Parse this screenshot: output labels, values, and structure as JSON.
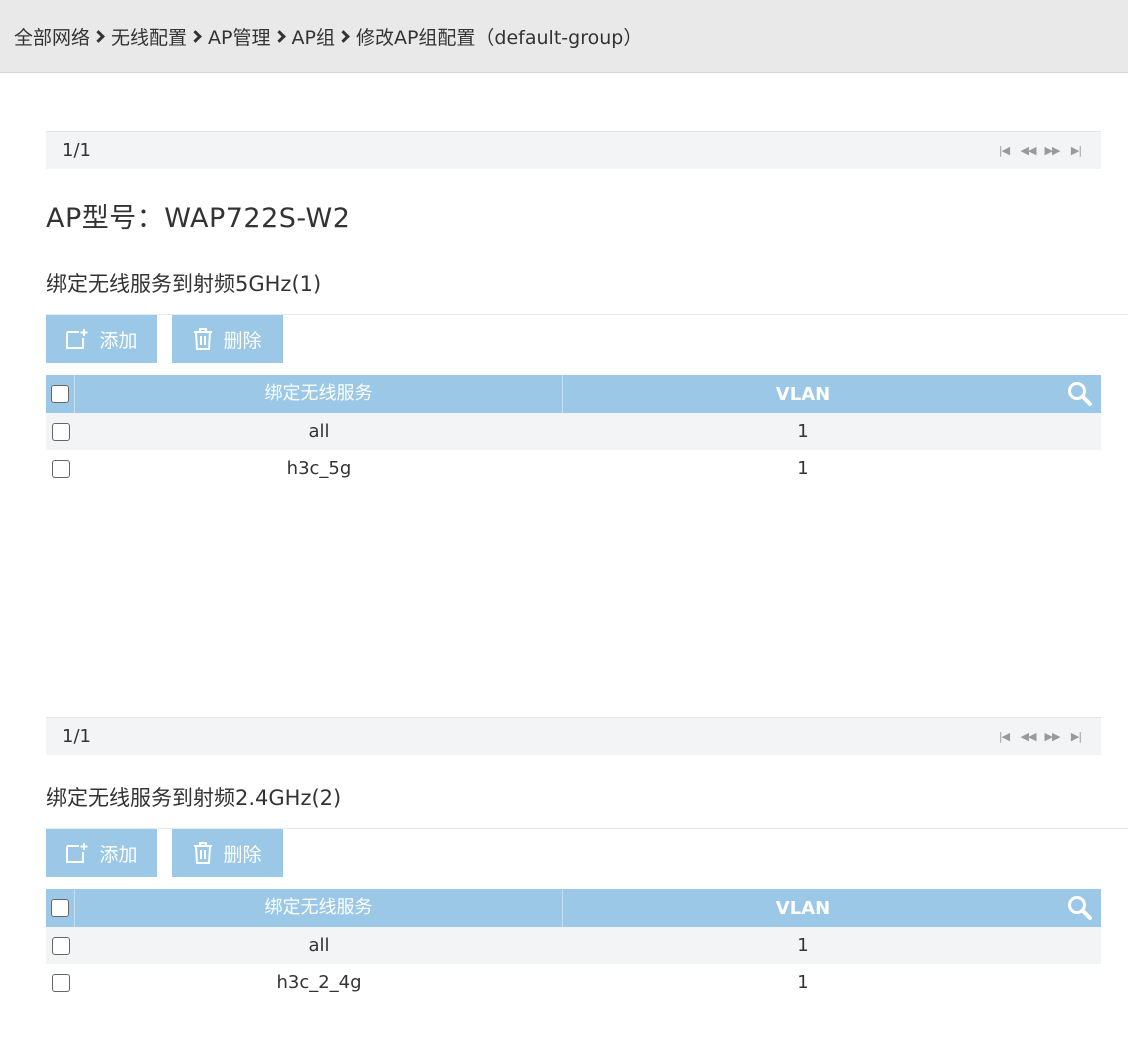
{
  "breadcrumb": [
    {
      "label": "全部网络"
    },
    {
      "label": "无线配置"
    },
    {
      "label": "AP管理"
    },
    {
      "label": "AP组"
    },
    {
      "label": "修改AP组配置（default-group）"
    }
  ],
  "pager_top": {
    "page": "1/1"
  },
  "model": {
    "label": "AP型号：",
    "value": "WAP722S-W2"
  },
  "sections": [
    {
      "title": "绑定无线服务到射频5GHz(1)",
      "add_label": "添加",
      "delete_label": "删除",
      "columns": {
        "name": "绑定无线服务",
        "vlan": "VLAN"
      },
      "rows": [
        {
          "name": "all",
          "vlan": "1"
        },
        {
          "name": "h3c_5g",
          "vlan": "1"
        }
      ],
      "pager": {
        "page": "1/1"
      }
    },
    {
      "title": "绑定无线服务到射频2.4GHz(2)",
      "add_label": "添加",
      "delete_label": "删除",
      "columns": {
        "name": "绑定无线服务",
        "vlan": "VLAN"
      },
      "rows": [
        {
          "name": "all",
          "vlan": "1"
        },
        {
          "name": "h3c_2_4g",
          "vlan": "1"
        }
      ]
    }
  ],
  "colors": {
    "accent": "#9ac8e6",
    "breadcrumb_bg": "#e9e9ea",
    "row_alt": "#f3f4f6"
  }
}
